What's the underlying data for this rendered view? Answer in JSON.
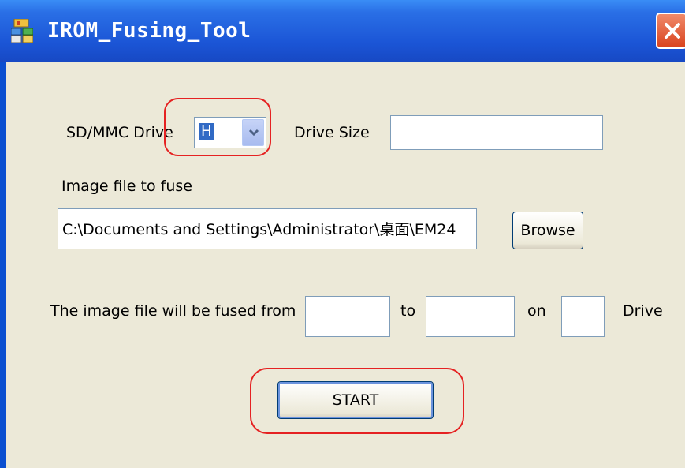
{
  "window": {
    "title": "IROM_Fusing_Tool",
    "icons": {
      "app": "app-icon",
      "close": "close-icon",
      "dropdown": "chevron-down-icon"
    }
  },
  "form": {
    "sd_drive_label": "SD/MMC Drive",
    "sd_drive_value": "H",
    "drive_size_label": "Drive Size",
    "drive_size_value": "",
    "image_file_label": "Image file to fuse",
    "image_file_path": "C:\\Documents and Settings\\Administrator\\桌面\\EM24",
    "browse_label": "Browse",
    "fuse_from_label": "The image file will be fused from",
    "from_value": "",
    "to_label": "to",
    "to_value": "",
    "on_label": "on",
    "on_value": "",
    "drive_label": "Drive",
    "start_label": "START"
  },
  "colors": {
    "titlebar": "#1b55d6",
    "window_bg": "#ece9d8",
    "highlight": "#e52222",
    "close_button": "#d9431e",
    "selection": "#316ac5"
  }
}
